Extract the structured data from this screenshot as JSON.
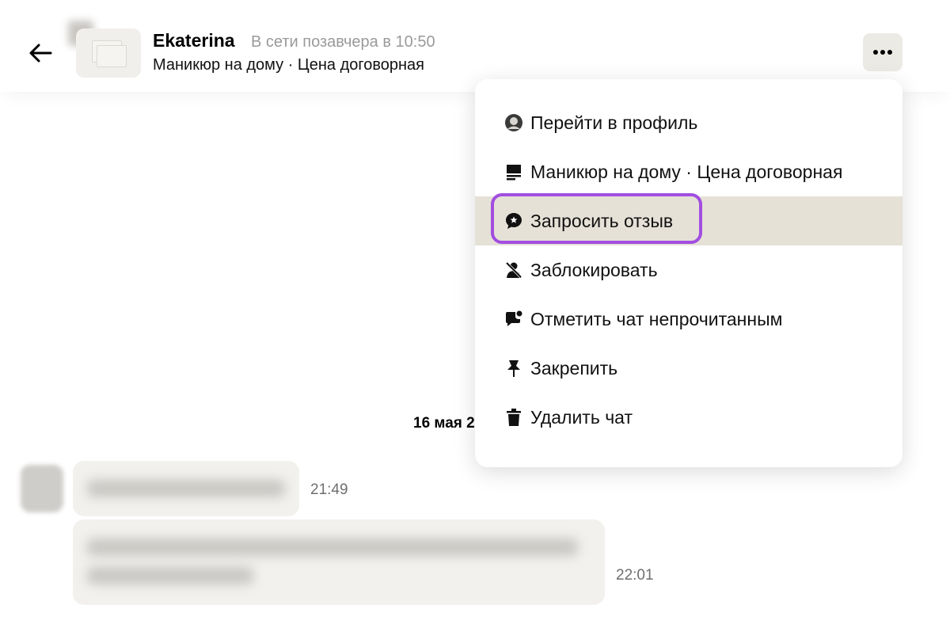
{
  "header": {
    "name": "Ekaterina",
    "status": "В сети позавчера в 10:50",
    "subtitle": "Маникюр на дому · Цена договорная"
  },
  "chat": {
    "date_divider": "16 мая 2",
    "messages": [
      {
        "time": "21:49"
      },
      {
        "time": "22:01"
      }
    ]
  },
  "menu": {
    "items": [
      {
        "label": "Перейти в профиль",
        "icon": "profile-avatar-icon"
      },
      {
        "label": "Маникюр на дому · Цена договорная",
        "icon": "listing-icon"
      },
      {
        "label": "Запросить отзыв",
        "icon": "review-star-bubble-icon",
        "active": true
      },
      {
        "label": "Заблокировать",
        "icon": "block-user-icon"
      },
      {
        "label": "Отметить чат непрочитанным",
        "icon": "unread-chat-icon"
      },
      {
        "label": "Закрепить",
        "icon": "pin-icon"
      },
      {
        "label": "Удалить чат",
        "icon": "trash-icon"
      }
    ]
  },
  "colors": {
    "active_row": "#e5e1d7",
    "highlight_ring": "#a24ee0",
    "more_button": "#eceae4"
  }
}
